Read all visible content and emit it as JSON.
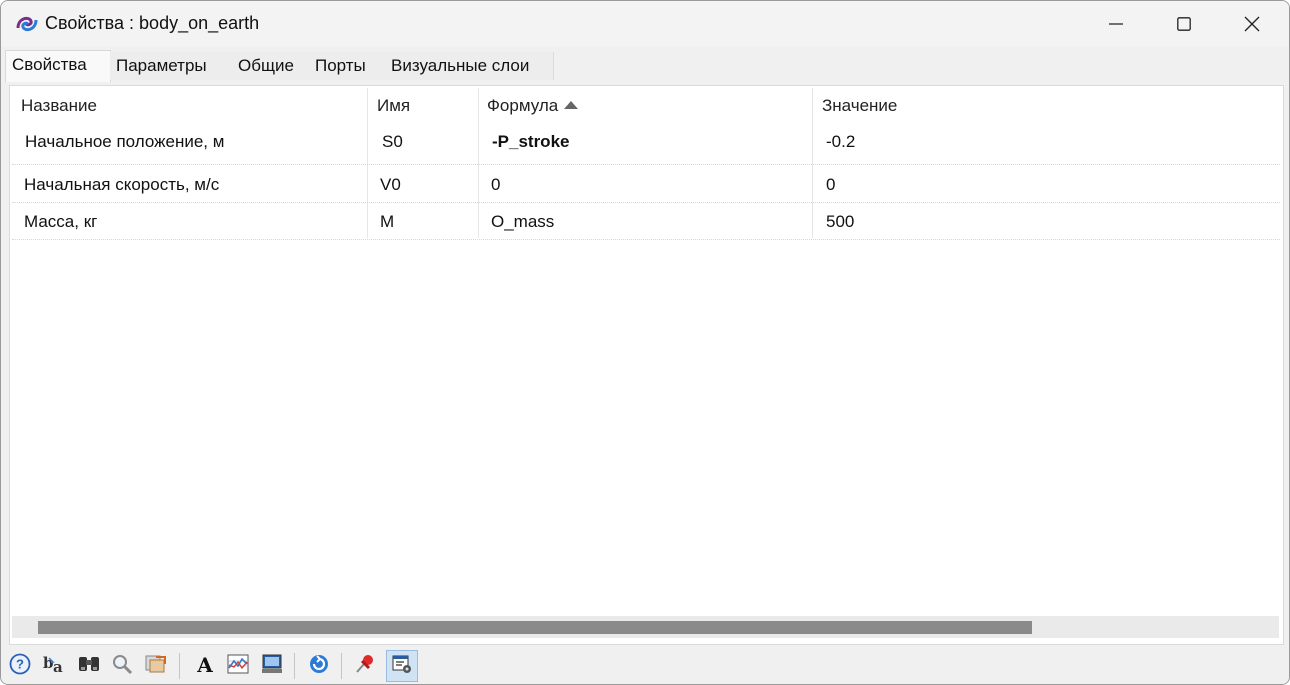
{
  "window": {
    "title": "Свойства : body_on_earth",
    "buttons": {
      "minimize": "minimize-icon",
      "maximize": "maximize-icon",
      "close": "close-icon"
    }
  },
  "tabs": [
    {
      "label": "Свойства",
      "active": true
    },
    {
      "label": "Параметры",
      "active": false
    },
    {
      "label": "Общие",
      "active": false
    },
    {
      "label": "Порты",
      "active": false
    },
    {
      "label": "Визуальные слои",
      "active": false
    }
  ],
  "table": {
    "columns": [
      "Название",
      "Имя",
      "Формула",
      "Значение"
    ],
    "sorted_column": "Формула",
    "sort_direction": "ascending",
    "rows": [
      {
        "name": "Начальное положение, м",
        "id": "S0",
        "formula": "-P_stroke",
        "value": "-0.2"
      },
      {
        "name": "Начальная скорость, м/с",
        "id": "V0",
        "formula": "0",
        "value": "0"
      },
      {
        "name": "Масса, кг",
        "id": "M",
        "formula": "O_mass",
        "value": "500"
      }
    ]
  },
  "toolbar": {
    "buttons": [
      "help-icon",
      "text-style-icon",
      "binoculars-icon",
      "magnifier-icon",
      "export-icon",
      "font-icon",
      "graph-icon",
      "monitor-icon",
      "refresh-icon",
      "pin-icon",
      "window-settings-icon"
    ],
    "pressed": "window-settings-icon"
  },
  "colors": {
    "accent": "#2e7bd6",
    "pressed_bg": "#cfe3f5"
  }
}
